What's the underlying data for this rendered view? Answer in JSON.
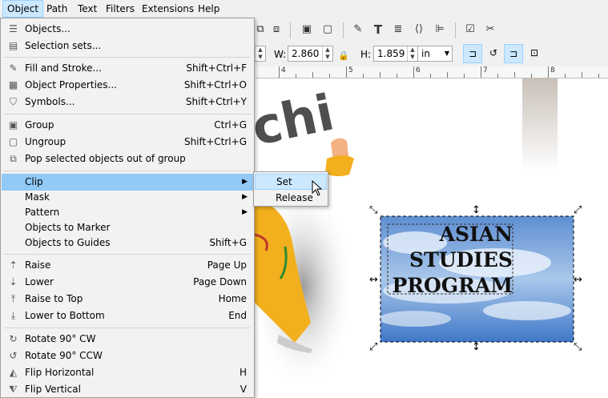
{
  "menubar": {
    "items": [
      "Object",
      "Path",
      "Text",
      "Filters",
      "Extensions",
      "Help"
    ]
  },
  "toolbar": {
    "w_label": "W:",
    "w_value": "2.860",
    "h_label": "H:",
    "h_value": "1.859",
    "unit": "in"
  },
  "ruler": {
    "marks": [
      "4",
      "5",
      "6",
      "7",
      "8"
    ]
  },
  "object_menu": {
    "items": [
      {
        "label": "Objects...",
        "shortcut": "",
        "icon": "objects-icon"
      },
      {
        "label": "Selection sets...",
        "shortcut": "",
        "icon": "selection-sets-icon"
      },
      {
        "label": "Fill and Stroke...",
        "shortcut": "Shift+Ctrl+F",
        "icon": "fill-stroke-icon"
      },
      {
        "label": "Object Properties...",
        "shortcut": "Shift+Ctrl+O",
        "icon": "object-properties-icon"
      },
      {
        "label": "Symbols...",
        "shortcut": "Shift+Ctrl+Y",
        "icon": "symbols-icon"
      },
      {
        "label": "Group",
        "shortcut": "Ctrl+G",
        "icon": "group-icon"
      },
      {
        "label": "Ungroup",
        "shortcut": "Shift+Ctrl+G",
        "icon": "ungroup-icon"
      },
      {
        "label": "Pop selected objects out of group",
        "shortcut": "",
        "icon": "pop-out-icon"
      },
      {
        "label": "Clip",
        "shortcut": "",
        "icon": ""
      },
      {
        "label": "Mask",
        "shortcut": "",
        "icon": ""
      },
      {
        "label": "Pattern",
        "shortcut": "",
        "icon": ""
      },
      {
        "label": "Objects to Marker",
        "shortcut": "",
        "icon": ""
      },
      {
        "label": "Objects to Guides",
        "shortcut": "Shift+G",
        "icon": ""
      },
      {
        "label": "Raise",
        "shortcut": "Page Up",
        "icon": "raise-icon"
      },
      {
        "label": "Lower",
        "shortcut": "Page Down",
        "icon": "lower-icon"
      },
      {
        "label": "Raise to Top",
        "shortcut": "Home",
        "icon": "raise-top-icon"
      },
      {
        "label": "Lower to Bottom",
        "shortcut": "End",
        "icon": "lower-bottom-icon"
      },
      {
        "label": "Rotate 90° CW",
        "shortcut": "",
        "icon": "rotate-cw-icon"
      },
      {
        "label": "Rotate 90° CCW",
        "shortcut": "",
        "icon": "rotate-ccw-icon"
      },
      {
        "label": "Flip Horizontal",
        "shortcut": "H",
        "icon": "flip-horizontal-icon"
      },
      {
        "label": "Flip Vertical",
        "shortcut": "V",
        "icon": "flip-vertical-icon"
      }
    ]
  },
  "clip_submenu": {
    "items": [
      "Set",
      "Release"
    ]
  },
  "canvas": {
    "partial_text": "chi",
    "banner_lines": [
      "ASIAN",
      "STUDIES",
      "PROGRAM"
    ]
  },
  "colors": {
    "menu_highlight": "#91c9f7",
    "submenu_highlight": "#cce8ff"
  }
}
